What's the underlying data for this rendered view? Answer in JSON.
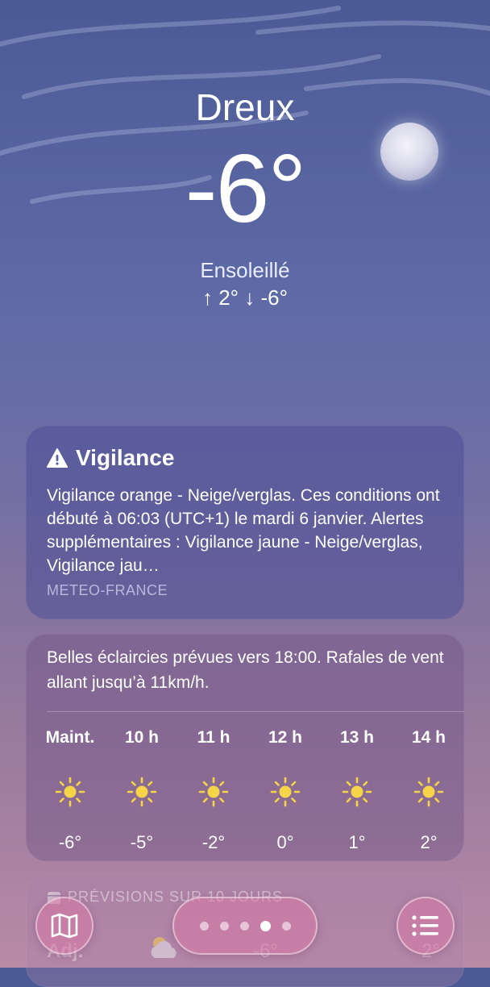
{
  "location": {
    "city": "Dreux",
    "temperature": "-6°",
    "condition": "Ensoleillé",
    "high_low": "↑ 2°  ↓ -6°"
  },
  "alert": {
    "title": "Vigilance",
    "text": "Vigilance orange - Neige/verglas. Ces conditions ont débuté à 06:03 (UTC+1) le mardi 6 janvier. Alertes supplémentaires : Vigilance jaune - Neige/verglas, Vigilance jau…",
    "source": "METEO-FRANCE",
    "icon": "warning-triangle-icon"
  },
  "hourly": {
    "summary": "Belles éclaircies prévues vers 18:00. Rafales de vent allant jusqu’à 11km/h.",
    "hours": [
      {
        "label": "Maint.",
        "temp": "-6°",
        "icon": "sun-icon"
      },
      {
        "label": "10 h",
        "temp": "-5°",
        "icon": "sun-icon"
      },
      {
        "label": "11 h",
        "temp": "-2°",
        "icon": "sun-icon"
      },
      {
        "label": "12 h",
        "temp": "0°",
        "icon": "sun-icon"
      },
      {
        "label": "13 h",
        "temp": "1°",
        "icon": "sun-icon"
      },
      {
        "label": "14 h",
        "temp": "2°",
        "icon": "sun-icon"
      }
    ]
  },
  "forecast": {
    "title": "PRÉVISIONS SUR 10 JOURS",
    "first_day": {
      "label": "Adj.",
      "low": "-6°",
      "high": "2°",
      "icon": "partly-cloudy-icon"
    }
  },
  "bottom_bar": {
    "map_icon": "map-icon",
    "list_icon": "list-icon",
    "page_count": 5,
    "active_page": 4
  },
  "colors": {
    "sun": "#f5d547",
    "accent_button": "#d878a8"
  }
}
